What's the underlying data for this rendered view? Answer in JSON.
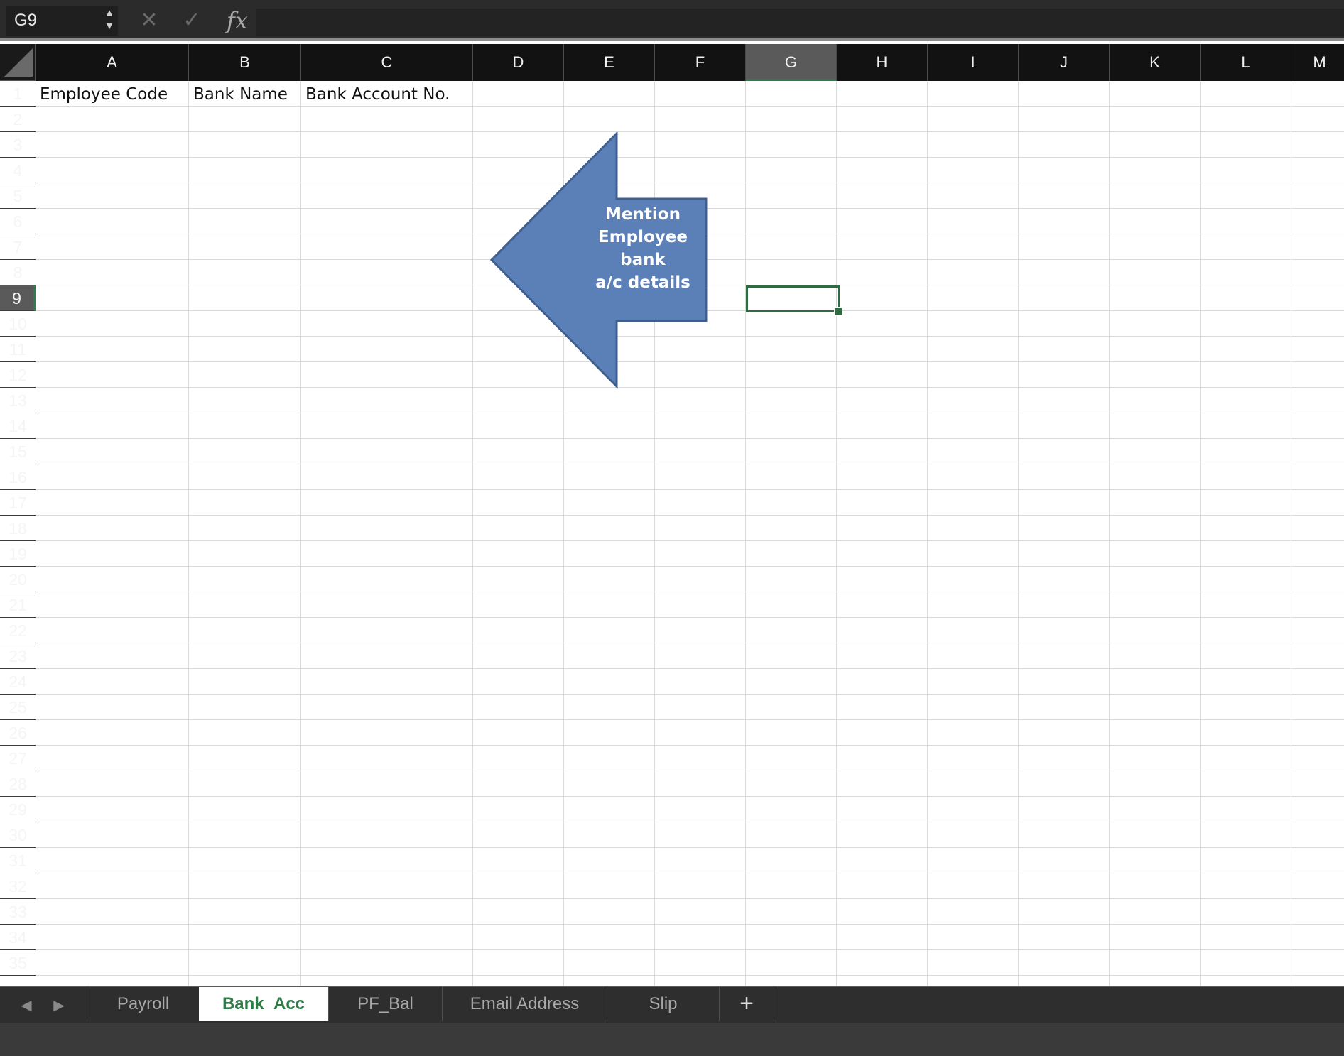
{
  "formula_bar": {
    "name_box": "G9",
    "stepper_up": "▲",
    "stepper_down": "▼",
    "cancel_glyph": "✕",
    "enter_glyph": "✓",
    "fx_label": "fx",
    "formula_value": ""
  },
  "columns": [
    "A",
    "B",
    "C",
    "D",
    "E",
    "F",
    "G",
    "H",
    "I",
    "J",
    "K",
    "L",
    "M"
  ],
  "selected_column": "G",
  "rows": [
    "1",
    "2",
    "3",
    "4",
    "5",
    "6",
    "7",
    "8",
    "9",
    "10",
    "11",
    "12",
    "13",
    "14",
    "15",
    "16",
    "17",
    "18",
    "19",
    "20",
    "21",
    "22",
    "23",
    "24",
    "25",
    "26",
    "27",
    "28",
    "29",
    "30",
    "31",
    "32",
    "33",
    "34",
    "35"
  ],
  "selected_row": "9",
  "cells": {
    "A1": "Employee Code",
    "B1": "Bank Name",
    "C1": "Bank Account No."
  },
  "callout": {
    "shape": "left-arrow",
    "fill_color": "#5b80b8",
    "line1": "Mention",
    "line2": "Employee bank",
    "line3": "a/c details"
  },
  "sheet_nav": {
    "prev": "◀",
    "next": "▶"
  },
  "sheet_tabs": [
    "Payroll",
    "Bank_Acc",
    "PF_Bal",
    "Email Address",
    "Slip"
  ],
  "active_tab": "Bank_Acc",
  "add_sheet_label": "+",
  "colors": {
    "accent_green": "#2e7d4f",
    "active_tab_text": "#2f7a47",
    "header_bg": "#121212"
  }
}
